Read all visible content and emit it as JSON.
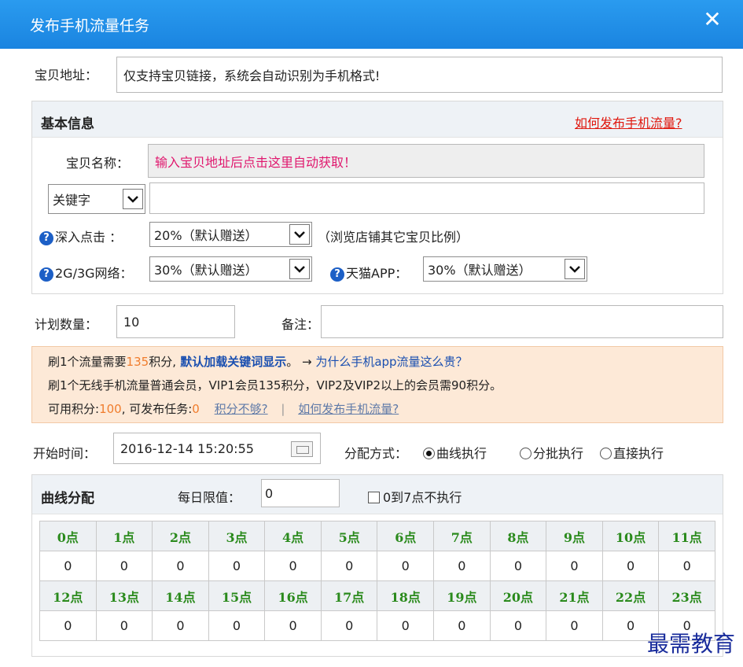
{
  "window": {
    "title": "发布手机流量任务",
    "close_glyph": "✕"
  },
  "item_url": {
    "label": "宝贝地址：",
    "value": "仅支持宝贝链接，系统会自动识别为手机格式!"
  },
  "basic": {
    "heading": "基本信息",
    "help_link": "如何发布手机流量?",
    "name_label": "宝贝名称：",
    "name_value": "输入宝贝地址后点击这里自动获取！",
    "keyword_select": "关键字",
    "keyword_value": "",
    "deep_click": {
      "label": "深入点击 ：",
      "value": "20%（默认赠送）",
      "hint": "（浏览店铺其它宝贝比例）"
    },
    "network": {
      "label": "2G/3G网络：",
      "value": "30%（默认赠送）"
    },
    "tmall": {
      "label": "天猫APP：",
      "value": "30%（默认赠送）"
    }
  },
  "plan": {
    "quantity_label": "计划数量：",
    "quantity_value": "10",
    "remark_label": "备注：",
    "remark_value": ""
  },
  "notice": {
    "line1_a": "刷1个流量需要",
    "line1_num": "135",
    "line1_b": "积分,",
    "line1_bold": " 默认加载关键词显示",
    "line1_c": "。 → ",
    "line1_link": "为什么手机app流量这么贵？",
    "line2": "刷1个无线手机流量普通会员，VIP1会员135积分，VIP2及VIP2以上的会员需90积分。",
    "line3_a": "可用积分:",
    "line3_points": "100",
    "line3_b": ", 可发布任务:",
    "line3_tasks": "0",
    "link_not_enough": "积分不够?",
    "separator": "|",
    "link_how": "如何发布手机流量?"
  },
  "schedule": {
    "start_label": "开始时间：",
    "start_value": "2016-12-14 15:20:55",
    "mode_label": "分配方式：",
    "modes": [
      "曲线执行",
      "分批执行",
      "直接执行"
    ],
    "selected_mode": 0
  },
  "curve": {
    "heading": "曲线分配",
    "daily_limit_label": "每日限值：",
    "daily_limit_value": "0",
    "skip_label": "0到7点不执行",
    "hours_top": [
      "0点",
      "1点",
      "2点",
      "3点",
      "4点",
      "5点",
      "6点",
      "7点",
      "8点",
      "9点",
      "10点",
      "11点"
    ],
    "values_top": [
      "0",
      "0",
      "0",
      "0",
      "0",
      "0",
      "0",
      "0",
      "0",
      "0",
      "0",
      "0"
    ],
    "hours_bottom": [
      "12点",
      "13点",
      "14点",
      "15点",
      "16点",
      "17点",
      "18点",
      "19点",
      "20点",
      "21点",
      "22点",
      "23点"
    ],
    "values_bottom": [
      "0",
      "0",
      "0",
      "0",
      "0",
      "0",
      "0",
      "0",
      "0",
      "0",
      "0",
      "0"
    ]
  },
  "watermark": "最需教育",
  "colors": {
    "titlebar": "#1a84e0",
    "hour_label": "#2a8a1c",
    "notice_bg": "#fde9d7",
    "link_red": "#e0180f"
  }
}
